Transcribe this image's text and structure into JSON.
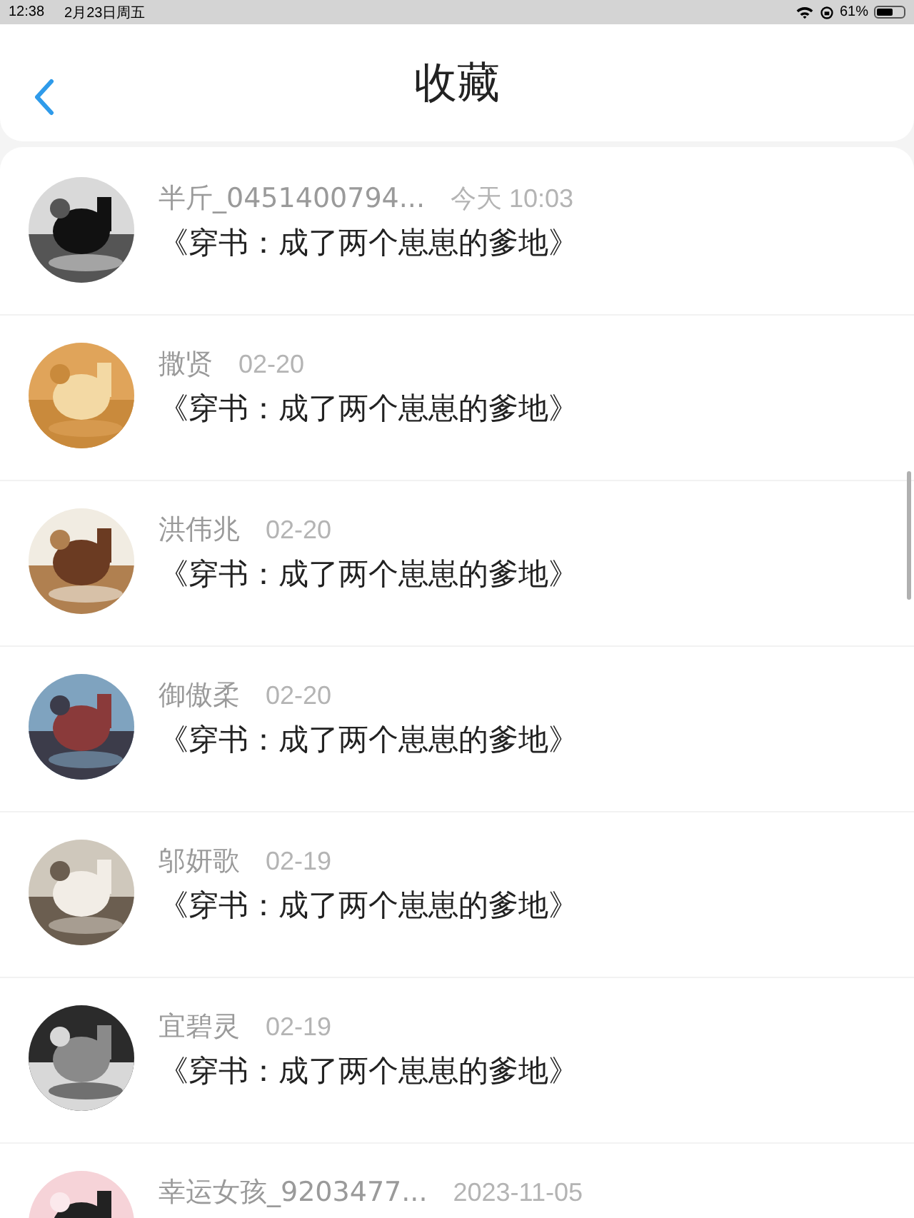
{
  "status_bar": {
    "time": "12:38",
    "date": "2月23日周五",
    "battery": "61%"
  },
  "header": {
    "title": "收藏"
  },
  "favorites": [
    {
      "user": "半斤_0451400794...",
      "time": "今天 10:03",
      "title": "《穿书：成了两个崽崽的爹地》"
    },
    {
      "user": "撒贤",
      "time": "02-20",
      "title": "《穿书：成了两个崽崽的爹地》"
    },
    {
      "user": "洪伟兆",
      "time": "02-20",
      "title": "《穿书：成了两个崽崽的爹地》"
    },
    {
      "user": "御傲柔",
      "time": "02-20",
      "title": "《穿书：成了两个崽崽的爹地》"
    },
    {
      "user": "邬妍歌",
      "time": "02-19",
      "title": "《穿书：成了两个崽崽的爹地》"
    },
    {
      "user": "宜碧灵",
      "time": "02-19",
      "title": "《穿书：成了两个崽崽的爹地》"
    },
    {
      "user": "幸运女孩_9203477...",
      "time": "2023-11-05"
    }
  ]
}
